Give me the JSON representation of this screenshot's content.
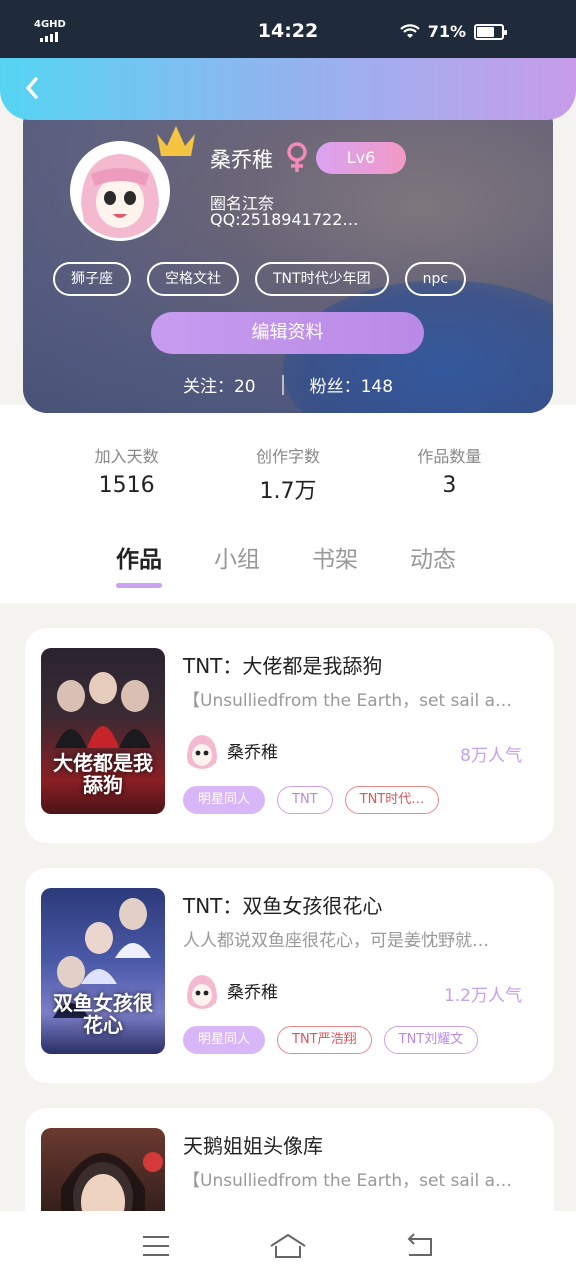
{
  "status": {
    "network": "4GHD",
    "time": "14:22",
    "battery_text": "71%",
    "battery_level": 0.71
  },
  "profile": {
    "name": "桑乔稚",
    "level": "Lv6",
    "circle": "圈名江奈",
    "qq": "QQ:2518941722…",
    "tags": [
      "狮子座",
      "空格文社",
      "TNT时代少年团",
      "npc"
    ],
    "edit_button": "编辑资料",
    "follow_label": "关注：",
    "follow_count": "20",
    "fans_label": "粉丝：",
    "fans_count": "148"
  },
  "stats": [
    {
      "label": "加入天数",
      "value": "1516"
    },
    {
      "label": "创作字数",
      "value": "1.7万"
    },
    {
      "label": "作品数量",
      "value": "3"
    }
  ],
  "tabs": [
    "作品",
    "小组",
    "书架",
    "动态"
  ],
  "works": [
    {
      "cover_text": "大佬都是我舔狗",
      "title": "TNT：大佬都是我舔狗",
      "desc": "【Unsulliedfrom the Earth，set sail a…",
      "author": "桑乔稚",
      "popularity": "8万人气",
      "tags": [
        "明星同人",
        "TNT",
        "TNT时代…"
      ]
    },
    {
      "cover_text": "双鱼女孩很花心",
      "title": "TNT：双鱼女孩很花心",
      "desc": "人人都说双鱼座很花心，可是姜忱野就…",
      "author": "桑乔稚",
      "popularity": "1.2万人气",
      "tags": [
        "明星同人",
        "TNT严浩翔",
        "TNT刘耀文"
      ]
    },
    {
      "title": "天鹅姐姐头像库",
      "desc": "【Unsulliedfrom the Earth，set sail a…"
    }
  ],
  "colors": {
    "accent": "#c9a3ef",
    "popularity": "#c6a0ec",
    "tag_red": "#d9585c"
  },
  "icons": {
    "back": "chevron-left-icon",
    "crown": "crown-icon",
    "gender": "female-icon",
    "nav": [
      "menu-icon",
      "home-icon",
      "back-icon"
    ]
  }
}
